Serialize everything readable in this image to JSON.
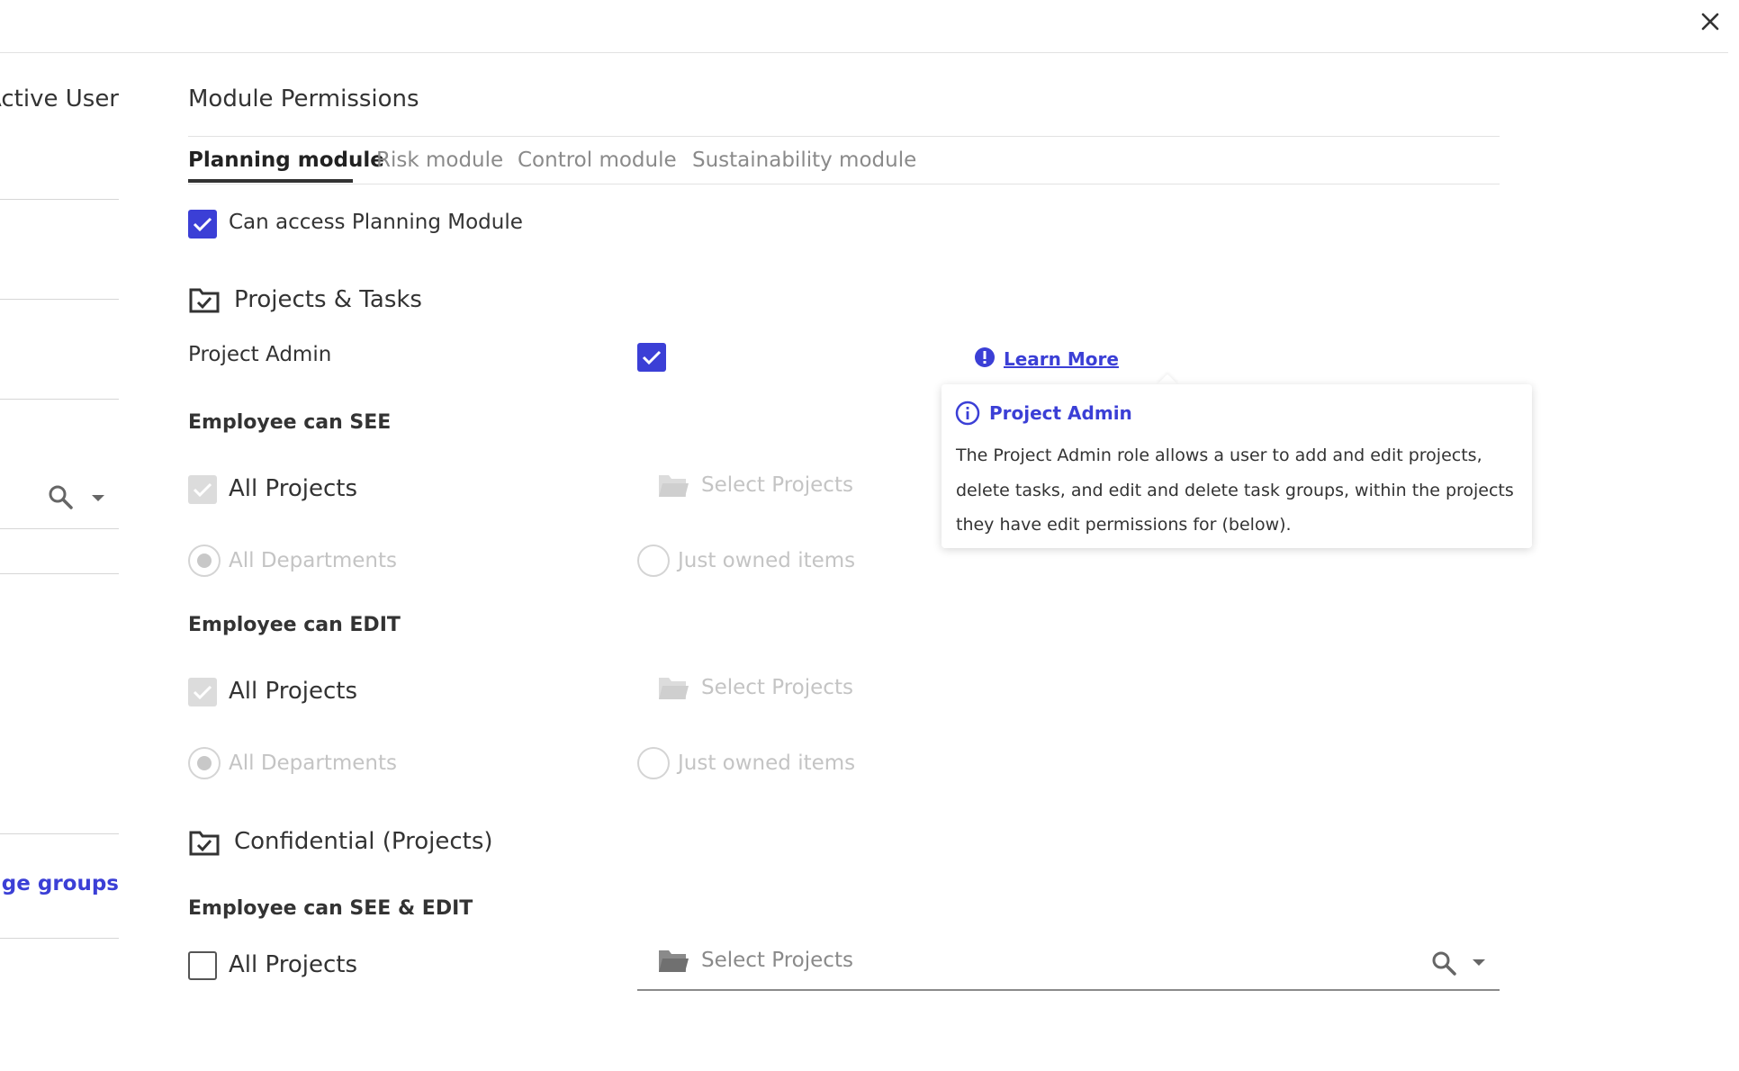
{
  "left_panel": {
    "title": "Active User",
    "groups_link": "nage groups"
  },
  "main": {
    "title": "Module Permissions",
    "tabs": [
      {
        "label": "Planning module",
        "active": true
      },
      {
        "label": "Risk module",
        "active": false
      },
      {
        "label": "Control module",
        "active": false
      },
      {
        "label": "Sustainability module",
        "active": false
      }
    ],
    "access_label": "Can access Planning Module",
    "projects_tasks": {
      "heading": "Projects & Tasks",
      "project_admin_label": "Project Admin",
      "learn_more": "Learn More",
      "see_heading": "Employee can SEE",
      "edit_heading": "Employee can EDIT",
      "all_projects": "All Projects",
      "select_projects": "Select Projects",
      "all_departments": "All Departments",
      "just_owned": "Just owned items"
    },
    "confidential": {
      "heading": "Confidential (Projects)",
      "see_edit_heading": "Employee can SEE & EDIT",
      "all_projects": "All Projects",
      "select_projects": "Select Projects"
    }
  },
  "tooltip": {
    "title": "Project Admin",
    "body": "The Project Admin role allows a user to add and edit projects, delete tasks, and edit and delete task groups, within the projects they have edit permissions for (below)."
  },
  "colors": {
    "accent": "#3b3fd6",
    "disabled": "#c4c4c4"
  }
}
